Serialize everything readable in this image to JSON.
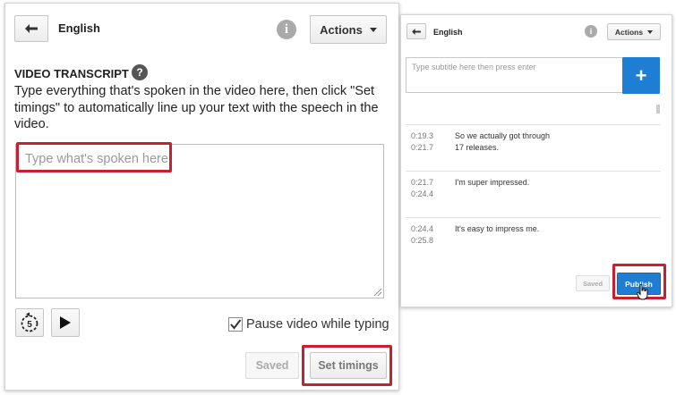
{
  "left_panel": {
    "back_icon": "arrow-left-icon",
    "title": "English",
    "info_icon": "info-icon",
    "info_glyph": "i",
    "actions_label": "Actions",
    "section_heading": "VIDEO TRANSCRIPT",
    "help_glyph": "?",
    "description": "Type everything that's spoken in the video here, then click \"Set timings\" to automatically line up your text with the speech in the video.",
    "transcript_placeholder": "Type what's spoken here",
    "replay_icon": "replay-5-seconds-icon",
    "replay_seconds": "5",
    "play_icon": "play-icon",
    "pause_checkbox_label": "Pause video while typing",
    "pause_checked": true,
    "saved_label": "Saved",
    "set_timings_label": "Set timings"
  },
  "right_panel": {
    "back_icon": "arrow-left-icon",
    "title": "English",
    "info_glyph": "i",
    "actions_label": "Actions",
    "subtitle_placeholder": "Type subtitle here then press enter",
    "add_glyph": "+",
    "cues": [
      {
        "start": "0:19.3",
        "end": "0:21.7",
        "text": "So we actually got through 17 releases."
      },
      {
        "start": "0:21.7",
        "end": "0:24.4",
        "text": "I'm super impressed."
      },
      {
        "start": "0:24.4",
        "end": "0:25.8",
        "text": "It's easy to impress me."
      }
    ],
    "saved_label": "Saved",
    "publish_label": "Publish"
  },
  "colors": {
    "accent_blue": "#1d7ed4",
    "highlight_red": "#c8202f"
  }
}
